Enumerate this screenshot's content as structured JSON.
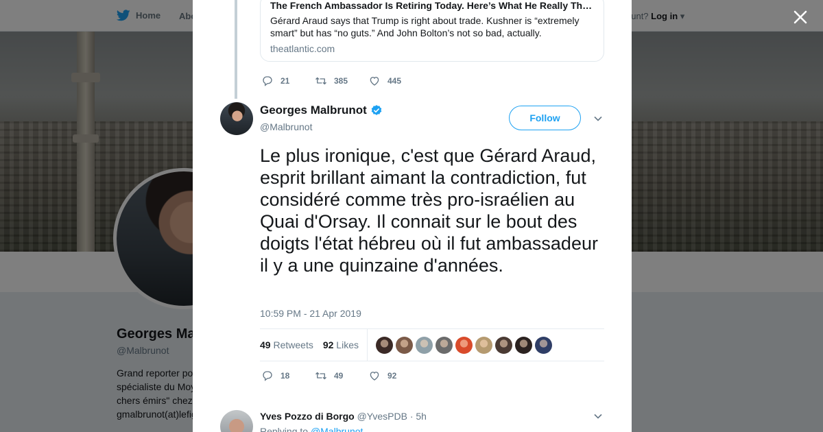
{
  "background": {
    "nav": {
      "home_label": "Home",
      "about_label": "Abo",
      "account_text": "ccount?",
      "login_label": "Log in"
    },
    "profile": {
      "name": "Georges Ma",
      "handle": "@Malbrunot",
      "bio_lines": [
        "Grand reporter po",
        "spécialiste du Moy",
        "chers émirs\" chez",
        "gmalbrunot(at)lefig"
      ]
    }
  },
  "modal": {
    "quoted_card": {
      "title": "The French Ambassador Is Retiring Today. Here’s What He Really Th…",
      "description": "Gérard Araud says that Trump is right about trade. Kushner is “extremely smart” but has “no guts.” And John Bolton’s not so bad, actually.",
      "domain": "theatlantic.com"
    },
    "parent_actions": {
      "replies": "21",
      "retweets": "385",
      "likes": "445"
    },
    "tweet": {
      "author_name": "Georges Malbrunot",
      "author_handle": "@Malbrunot",
      "follow_label": "Follow",
      "text": "Le plus ironique, c'est que Gérard Araud, esprit brillant aimant la contradiction, fut considéré comme très pro-israélien au Quai d'Orsay. Il connait sur le bout des doigts l'état hébreu où il fut ambassadeur il y a une quinzaine d'années.",
      "timestamp": "10:59 PM - 21 Apr 2019",
      "retweets_count": "49",
      "retweets_label": "Retweets",
      "likes_count": "92",
      "likes_label": "Likes",
      "liker_colors": [
        "#3b2a26",
        "#7b5a48",
        "#8fa0a8",
        "#6b6b6b",
        "#d94b2b",
        "#b59a70",
        "#4a3a33",
        "#2b2220",
        "#2f3e66"
      ],
      "actions": {
        "replies": "18",
        "retweets": "49",
        "likes": "92"
      }
    },
    "reply": {
      "author_name": "Yves Pozzo di Borgo",
      "author_handle": "@YvesPDB",
      "time": "· 5h",
      "replying_prefix": "Replying to",
      "replying_handle": "@Malbrunot"
    }
  },
  "colors": {
    "accent": "#1da1f2",
    "verified": "#1da1f2",
    "muted": "#657786"
  },
  "icons": [
    "twitter-bird-icon",
    "close-icon",
    "reply-icon",
    "retweet-icon",
    "heart-icon",
    "verified-badge-icon",
    "chevron-down-icon"
  ]
}
